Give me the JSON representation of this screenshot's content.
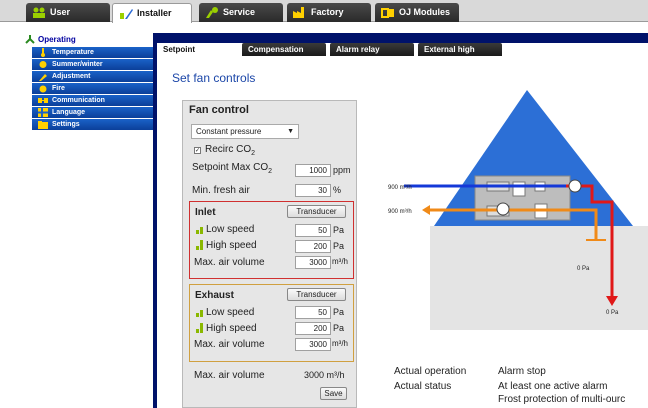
{
  "top_tabs": [
    {
      "label": "User",
      "icon": "users-icon"
    },
    {
      "label": "Installer",
      "icon": "installer-icon"
    },
    {
      "label": "Service",
      "icon": "service-icon"
    },
    {
      "label": "Factory",
      "icon": "factory-icon"
    },
    {
      "label": "OJ Modules",
      "icon": "modules-icon"
    }
  ],
  "sidebar": {
    "head": "Operating",
    "items": [
      "Temperature",
      "Summer/winter",
      "Adjustment",
      "Fire",
      "Communication",
      "Language",
      "Settings"
    ]
  },
  "sub_tabs": [
    "Setpoint",
    "Compensation",
    "Alarm relay",
    "External high"
  ],
  "page_title": "Set fan controls",
  "fan_control": {
    "title": "Fan control",
    "mode": "Constant pressure",
    "recirc_label": "Recirc CO",
    "recirc_sub": "2",
    "setpoint_label": "Setpoint Max CO",
    "setpoint_sub": "2",
    "setpoint_value": "1000",
    "setpoint_unit": "ppm",
    "min_fresh_label": "Min. fresh air",
    "min_fresh_value": "30",
    "min_fresh_unit": "%",
    "max_air_label": "Max. air volume",
    "max_air_value": "3000 m³/h",
    "save_label": "Save"
  },
  "inlet": {
    "title": "Inlet",
    "transducer_label": "Transducer",
    "low_label": "Low speed",
    "low_value": "50",
    "low_unit": "Pa",
    "high_label": "High speed",
    "high_value": "200",
    "high_unit": "Pa",
    "max_label": "Max. air volume",
    "max_value": "3000",
    "max_unit": "m³/h"
  },
  "exhaust": {
    "title": "Exhaust",
    "transducer_label": "Transducer",
    "low_label": "Low speed",
    "low_value": "50",
    "low_unit": "Pa",
    "high_label": "High speed",
    "high_value": "200",
    "high_unit": "Pa",
    "max_label": "Max. air volume",
    "max_value": "3000",
    "max_unit": "m³/h"
  },
  "diagram": {
    "flow_in": "900 m³/h",
    "flow_out": "900 m³/h",
    "pressure_orange": "0 Pa",
    "pressure_red": "0 Pa"
  },
  "status": {
    "actual_operation_label": "Actual operation",
    "actual_operation_value": "Alarm stop",
    "actual_status_label": "Actual status",
    "actual_status_value": "At least one active alarm",
    "actual_status_value2": "Frost protection of multi-ourc"
  },
  "colors": {
    "navy": "#00126a",
    "sidebar_blue": "#1a62c8",
    "title_blue": "#1b46a8",
    "inlet_border": "#d03030",
    "exhaust_border": "#d0a040"
  }
}
